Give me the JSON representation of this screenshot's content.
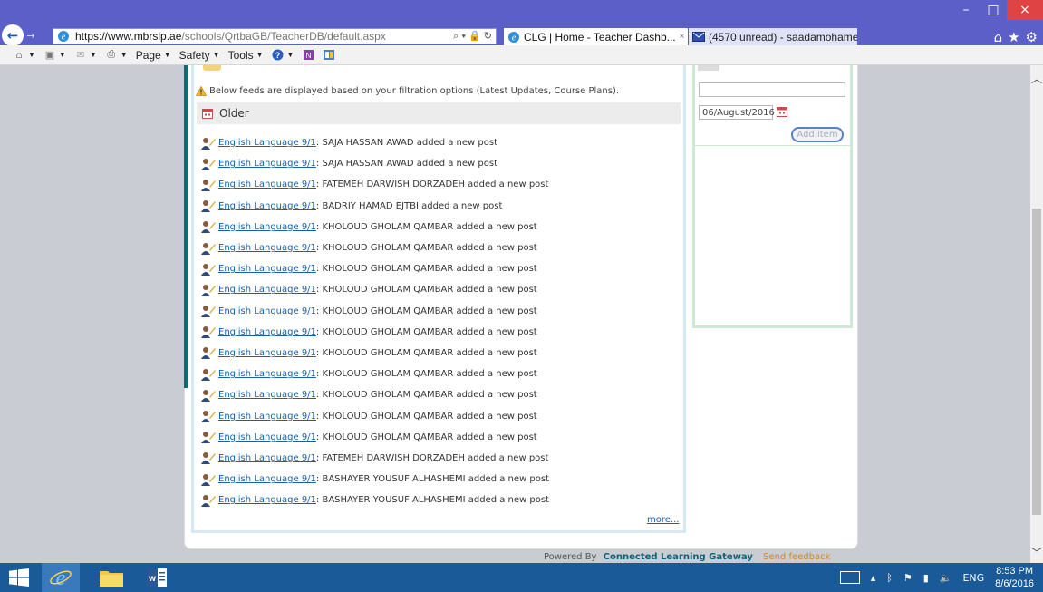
{
  "browser": {
    "window_controls": {
      "minimize": "–",
      "maximize": "□",
      "close": "×"
    },
    "address": {
      "host": "https://www.mbrslp.ae",
      "path": "/schools/QrtbaGB/TeacherDB/default.aspx"
    },
    "address_controls": "⌕ ▾ 🔒 ↻",
    "tabs": [
      {
        "title": "CLG | Home - Teacher Dashb...",
        "close": "×"
      },
      {
        "title": "(4570 unread) - saadamohame..."
      }
    ],
    "command_bar": [
      "Page",
      "Safety",
      "Tools"
    ],
    "right_icons": [
      "home-icon",
      "favorites-icon",
      "settings-icon"
    ]
  },
  "feed": {
    "notice": "Below feeds are displayed based on your filtration options (Latest Updates, Course Plans).",
    "group_label": "Older",
    "items": [
      {
        "course": "English Language 9/1",
        "text": ": SAJA HASSAN AWAD added a new post"
      },
      {
        "course": "English Language 9/1",
        "text": ": SAJA HASSAN AWAD added a new post"
      },
      {
        "course": "English Language 9/1",
        "text": ": FATEMEH DARWISH DORZADEH added a new post"
      },
      {
        "course": "English Language 9/1",
        "text": ": BADRIY HAMAD EJTBI added a new post"
      },
      {
        "course": "English Language 9/1",
        "text": ": KHOLOUD GHOLAM QAMBAR added a new post"
      },
      {
        "course": "English Language 9/1",
        "text": ": KHOLOUD GHOLAM QAMBAR added a new post"
      },
      {
        "course": "English Language 9/1",
        "text": ": KHOLOUD GHOLAM QAMBAR added a new post"
      },
      {
        "course": "English Language 9/1",
        "text": ": KHOLOUD GHOLAM QAMBAR added a new post"
      },
      {
        "course": "English Language 9/1",
        "text": ": KHOLOUD GHOLAM QAMBAR added a new post"
      },
      {
        "course": "English Language 9/1",
        "text": ": KHOLOUD GHOLAM QAMBAR added a new post"
      },
      {
        "course": "English Language 9/1",
        "text": ": KHOLOUD GHOLAM QAMBAR added a new post"
      },
      {
        "course": "English Language 9/1",
        "text": ": KHOLOUD GHOLAM QAMBAR added a new post"
      },
      {
        "course": "English Language 9/1",
        "text": ": KHOLOUD GHOLAM QAMBAR added a new post"
      },
      {
        "course": "English Language 9/1",
        "text": ": KHOLOUD GHOLAM QAMBAR added a new post"
      },
      {
        "course": "English Language 9/1",
        "text": ": KHOLOUD GHOLAM QAMBAR added a new post"
      },
      {
        "course": "English Language 9/1",
        "text": ": FATEMEH DARWISH DORZADEH added a new post"
      },
      {
        "course": "English Language 9/1",
        "text": ": BASHAYER YOUSUF ALHASHEMI added a new post"
      },
      {
        "course": "English Language 9/1",
        "text": ": BASHAYER YOUSUF ALHASHEMI added a new post"
      }
    ],
    "more_label": "more..."
  },
  "side_panel": {
    "text_input_value": "",
    "date_value": "06/August/2016",
    "add_item_label": "Add item"
  },
  "footer": {
    "powered_by": "Powered By",
    "brand": "Connected Learning Gateway",
    "feedback": "Send feedback"
  },
  "taskbar": {
    "language": "ENG",
    "time": "8:53 PM",
    "date": "8/6/2016"
  },
  "colors": {
    "titlebar": "#5b5fc7",
    "taskbar": "#1a5a99",
    "link": "#1a5faa",
    "teal_accent": "#0d6b78"
  }
}
